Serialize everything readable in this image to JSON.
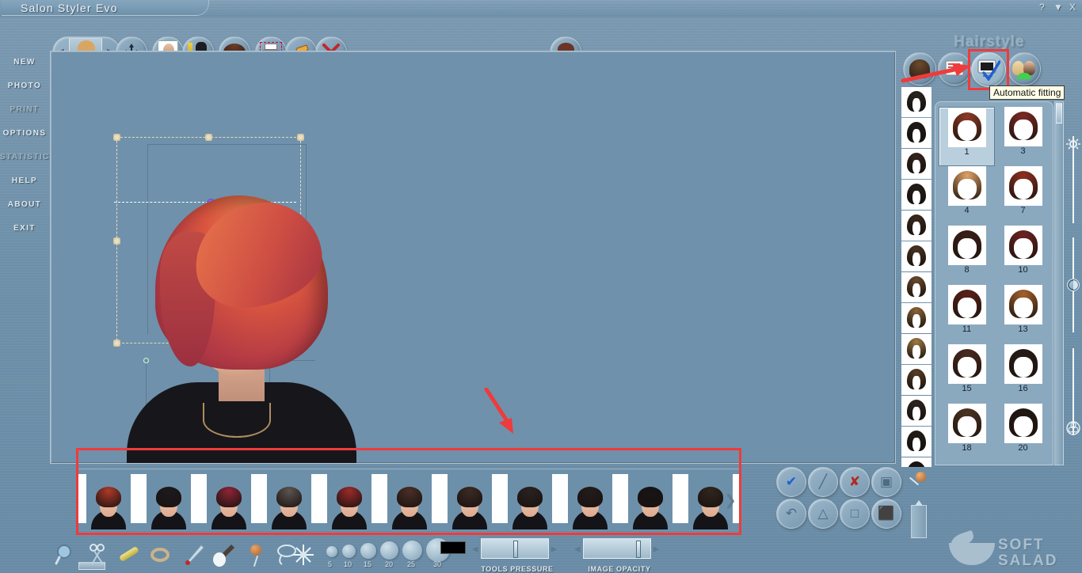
{
  "window": {
    "title": "Salon Styler Evo",
    "controls": [
      {
        "name": "help",
        "glyph": "?"
      },
      {
        "name": "minimize",
        "glyph": "▼"
      },
      {
        "name": "close",
        "glyph": "X"
      }
    ]
  },
  "toolbar": {
    "prev_label": "◀",
    "next_label": "▶",
    "buttons": [
      {
        "name": "move-tool",
        "icon": "move-arrows-icon"
      },
      {
        "name": "photo-tool",
        "icon": "photo-icon"
      },
      {
        "name": "makeup-tool",
        "icon": "makeup-icon"
      },
      {
        "name": "hairstyle-tool",
        "icon": "hair-icon"
      },
      {
        "name": "print-tool",
        "icon": "print-icon"
      },
      {
        "name": "eraser-tool",
        "icon": "eraser-icon"
      },
      {
        "name": "close-tool",
        "icon": "red-x-icon"
      }
    ],
    "model_button_icon": "model-face-icon"
  },
  "sidebar": {
    "items": [
      {
        "label": "NEW",
        "enabled": true
      },
      {
        "label": "PHOTO",
        "enabled": true
      },
      {
        "label": "PRINT",
        "enabled": false
      },
      {
        "label": "OPTIONS",
        "enabled": true
      },
      {
        "label": "STATISTICS",
        "enabled": false
      },
      {
        "label": "HELP",
        "enabled": true
      },
      {
        "label": "ABOUT",
        "enabled": true
      },
      {
        "label": "EXIT",
        "enabled": true
      }
    ]
  },
  "right_panel": {
    "title": "Hairstyle",
    "tooltip": "Automatic fitting",
    "mode_buttons": [
      {
        "name": "hair-model-button",
        "icon": "updo-hair-icon"
      },
      {
        "name": "hair-list-button",
        "icon": "list-icon"
      },
      {
        "name": "automatic-fitting-button",
        "icon": "monitor-check-icon",
        "selected": true
      },
      {
        "name": "compare-faces-button",
        "icon": "two-faces-icon"
      }
    ],
    "color_strip_count": 13,
    "color_strip_colors": [
      "#2a2420",
      "#1f1a17",
      "#33251c",
      "#241d19",
      "#3a2a1e",
      "#4a3422",
      "#6b4a2c",
      "#8c6537",
      "#a07a45",
      "#5a3e27",
      "#2e2420",
      "#221c18",
      "#171310"
    ],
    "grid": {
      "selected": "1",
      "items": [
        {
          "number": "1",
          "color": "#8f3a25"
        },
        {
          "number": "3",
          "color": "#7d2a24"
        },
        {
          "number": "4",
          "color": "#dfa366"
        },
        {
          "number": "7",
          "color": "#8e2f20"
        },
        {
          "number": "8",
          "color": "#3b2018"
        },
        {
          "number": "10",
          "color": "#6d2320"
        },
        {
          "number": "11",
          "color": "#5b2118"
        },
        {
          "number": "13",
          "color": "#a6632c"
        },
        {
          "number": "15",
          "color": "#4a2b20"
        },
        {
          "number": "16",
          "color": "#241b17"
        },
        {
          "number": "18",
          "color": "#4c3422"
        },
        {
          "number": "20",
          "color": "#1e1713"
        }
      ]
    }
  },
  "adjust_sliders": [
    {
      "name": "brightness-slider",
      "icon": "sun-icon",
      "value_pct": 0
    },
    {
      "name": "contrast-slider",
      "icon": "half-circle-icon",
      "value_pct": 50
    },
    {
      "name": "saturation-slider",
      "icon": "color-wheel-icon",
      "value_pct": 100
    }
  ],
  "actions": {
    "buttons": [
      {
        "name": "apply-button",
        "icon": "check-icon",
        "glyph": "✔"
      },
      {
        "name": "disable-button",
        "icon": "slash-icon",
        "glyph": "╱"
      },
      {
        "name": "cancel-button",
        "icon": "red-x-icon",
        "glyph": "✘"
      },
      {
        "name": "duplicate-button",
        "icon": "copy-screens-icon",
        "glyph": "▣"
      },
      {
        "name": "undo-button",
        "icon": "undo-arrow-icon",
        "glyph": "↶"
      },
      {
        "name": "lasso-button",
        "icon": "lasso-icon",
        "glyph": "△"
      },
      {
        "name": "rectangle-button",
        "icon": "rectangle-icon",
        "glyph": "□"
      },
      {
        "name": "save-button",
        "icon": "save-box-icon",
        "glyph": "⬛"
      }
    ],
    "extra": [
      {
        "name": "color-picker-tool",
        "icon": "pin-icon"
      },
      {
        "name": "measure-tool",
        "icon": "ruler-icon"
      }
    ]
  },
  "bottom_bar": {
    "tools": [
      {
        "name": "zoom-tool",
        "icon": "magnifier-icon"
      },
      {
        "name": "scissors-tool",
        "icon": "scissors-icon"
      },
      {
        "name": "comb-tool",
        "icon": "comb-icon"
      },
      {
        "name": "curl-tool",
        "icon": "curl-ring-icon"
      },
      {
        "name": "pen-tool",
        "icon": "pen-icon"
      },
      {
        "name": "brush-tool",
        "icon": "brush-icon"
      },
      {
        "name": "sponge-tool",
        "icon": "sponge-icon"
      },
      {
        "name": "lasso-loop-tool",
        "icon": "lasso-loop-icon"
      },
      {
        "name": "sparkle-tool",
        "icon": "sparkle-icon"
      }
    ],
    "brush_sizes": [
      "5",
      "10",
      "15",
      "20",
      "25",
      "30"
    ],
    "color_swatch": "#000000",
    "sliders": [
      {
        "name": "tools-pressure-slider",
        "label": "TOOLS PRESSURE",
        "value_pct": 42
      },
      {
        "name": "image-opacity-slider",
        "label": "IMAGE OPACITY",
        "value_pct": 80
      }
    ]
  },
  "filmstrip": {
    "items": [
      {
        "hair_color": "#b03a2a",
        "index": "1"
      },
      {
        "hair_color": "#1c1a1e",
        "index": "2"
      },
      {
        "hair_color": "#8e2535",
        "index": "3"
      },
      {
        "hair_color": "#5b5550",
        "index": "4"
      },
      {
        "hair_color": "#9d2b2b",
        "index": "5"
      },
      {
        "hair_color": "#4a2f26",
        "index": "6"
      },
      {
        "hair_color": "#3b2a24",
        "index": "7"
      },
      {
        "hair_color": "#2a2220",
        "index": "8"
      },
      {
        "hair_color": "#221c1a",
        "index": "9"
      },
      {
        "hair_color": "#171416",
        "index": "10"
      },
      {
        "hair_color": "#30261f",
        "index": "11"
      }
    ],
    "next_glyph": "❯"
  },
  "annotations": {
    "arrow_color": "#ef3b3b",
    "highlight_color": "#ef3b3b"
  },
  "watermark": {
    "line1": "SOFT",
    "line2": "SALAD"
  }
}
